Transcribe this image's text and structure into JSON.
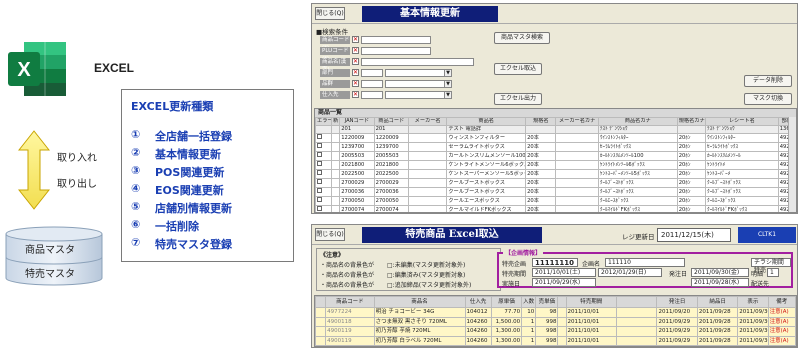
{
  "left": {
    "excel_label": "EXCEL",
    "arrow_in": "取り入れ",
    "arrow_out": "取り出し",
    "db_labels": [
      "商品マスタ",
      "特売マスタ"
    ],
    "types_title": "EXCEL更新種類",
    "types": [
      {
        "num": "①",
        "label": "全店舗一括登録"
      },
      {
        "num": "②",
        "label": "基本情報更新"
      },
      {
        "num": "③",
        "label": "POS関連更新"
      },
      {
        "num": "④",
        "label": "EOS関連更新"
      },
      {
        "num": "⑤",
        "label": "店舗別情報更新"
      },
      {
        "num": "⑥",
        "label": "一括削除"
      },
      {
        "num": "⑦",
        "label": "特売マスタ登録"
      }
    ]
  },
  "win1": {
    "close": "閉じる(Q)",
    "title": "基本情報更新",
    "search_label": "■検索条件",
    "fields": [
      "商品コード(*)",
      "PLUコード(*)",
      "商品名(漢字)",
      "部門",
      "品群",
      "仕入先"
    ],
    "field_checks": [
      "✕",
      "✕",
      "✕",
      "✕",
      "✕",
      "✕"
    ],
    "buttons": {
      "master_search": "商品マスタ検索",
      "excel_in": "エクセル取込",
      "excel_out": "エクセル出力",
      "data_delete": "データ削除",
      "mask_switch": "マスク切換"
    },
    "grid_title": "商品一覧",
    "headers": [
      "エラー",
      "新",
      "JANコード",
      "商品コード",
      "メーカー名",
      "商品名",
      "規格名",
      "メーカー名カナ",
      "商品名カナ",
      "規格名カナ",
      "レシート名",
      "部門"
    ],
    "filter_row": [
      "",
      "",
      "201",
      "201",
      "",
      "テスト 電話詳",
      "",
      "",
      "ﾃｽﾄ ﾃﾞﾝﾜｼｮｳ",
      "",
      "ﾃｽﾄ ﾃﾞﾝﾜｼｮｳ",
      "136"
    ],
    "rows": [
      [
        "1220009",
        "1220009",
        "",
        "ウィンストンフィルター",
        "20本",
        "",
        "ｳｲﾝｽﾄﾝﾌｨﾙﾀｰ",
        "20ﾎﾝ",
        "ｳｲﾝｽﾄﾝﾌｨﾙﾀｰ",
        "492"
      ],
      [
        "1239700",
        "1239700",
        "",
        "セーラムライトボックス",
        "20本",
        "",
        "ｾｰﾗﾑﾗｲﾄﾎﾞｯｸｽ",
        "20ﾎﾝ",
        "ｾｰﾗﾑﾗｲﾄﾎﾞｯｸｽ",
        "492"
      ],
      [
        "2005503",
        "2005503",
        "",
        "カールトンスリムメンソール100",
        "20本",
        "",
        "ｶｰﾙﾄﾝｽﾘﾑﾒﾝｿｰﾙ100",
        "20ﾎﾝ",
        "ｶｰﾙﾄﾝｽﾘﾑﾒﾝｿｰﾙ",
        "492"
      ],
      [
        "2021800",
        "2021800",
        "",
        "ケントライトメンソール6ボックス",
        "20本",
        "",
        "ｹﾝﾄﾗｲﾄﾒﾝｿｰﾙ6ﾎﾞｯｸｽ",
        "20ﾎﾝ",
        "ｹﾝﾄﾗｲﾄﾒ",
        "492"
      ],
      [
        "2022500",
        "2022500",
        "",
        "ケントスーパーメンソール5ボックス",
        "20本",
        "",
        "ｹﾝﾄｽｰﾊﾟｰﾒﾝｿｰﾙ5ﾎﾞｯｸｽ",
        "20ﾎﾝ",
        "ｹﾝﾄｽｰﾊﾟｰﾒ",
        "492"
      ],
      [
        "2700029",
        "2700029",
        "",
        "クールブーストボックス",
        "20本",
        "",
        "ｸｰﾙﾌﾞｰｽﾄﾎﾞｯｸｽ",
        "20ﾎﾝ",
        "ｸｰﾙﾌﾞｰｽﾄﾎﾞｯｸｽ",
        "492"
      ],
      [
        "2700036",
        "2700036",
        "",
        "クールブーストボックス",
        "20本",
        "",
        "ｸｰﾙﾌﾞｰｽﾄﾎﾞｯｸｽ",
        "20ﾎﾝ",
        "ｸｰﾙﾌﾞｰｽﾄﾎﾞｯｸｽ",
        "492"
      ],
      [
        "2700050",
        "2700050",
        "",
        "クールエースボックス",
        "20本",
        "",
        "ｸｰﾙｴｰｽﾎﾞｯｸｽ",
        "20ﾎﾝ",
        "ｸｰﾙｴｰｽﾎﾞｯｸｽ",
        "492"
      ],
      [
        "2700074",
        "2700074",
        "",
        "クールマイルドFKボックス",
        "20本",
        "",
        "ｸｰﾙﾏｲﾙﾄﾞFKﾎﾞｯｸｽ",
        "20ﾎﾝ",
        "ｸｰﾙﾏｲﾙﾄﾞFKﾎﾞｯｸｽ",
        "492"
      ]
    ]
  },
  "win2": {
    "close": "閉じる(Q)",
    "title": "特売商品 Excel取込",
    "reg_label": "レジ更新日",
    "reg_date": "2011/12/15(木)",
    "cltk": "CLTK1",
    "notice_title": "《注意》",
    "notices": [
      "・商品名の背景色が",
      "・商品名の背景色が",
      "・商品名の背景色が"
    ],
    "notice_vals": [
      "□:未編集(マスタ更新対象外)",
      "□:編集済み(マスタ更新対象)",
      "□:追加締品(マスタ更新対象外)"
    ],
    "info_title": "【企画情報】",
    "kikaku_label": "特売企画",
    "kikaku_code": "11111110",
    "kikaku_name_label": "企画名",
    "kikaku_name": "111110",
    "kikan_label": "特売期間",
    "kikan_from": "2011/10/01(土)",
    "kikan_to": "2012/01/29(日)",
    "jisshi_label": "実施日",
    "jisshi_date": "2011/09/29(水)",
    "hacchu_label": "発注日",
    "hacchu_from": "2011/09/30(金)",
    "hacchu_to": "2011/09/28(水)",
    "chirashi_label": "チラシ期間特売",
    "meisai_label": "明細",
    "meisai_val": "1",
    "haiso_label": "配送先",
    "grid2_headers": [
      "",
      "商品コード",
      "商品名",
      "仕入先",
      "原単価",
      "入数",
      "売単価",
      "",
      "特売期間",
      "",
      "発注日",
      "納品日",
      "表示",
      "備考"
    ],
    "grid2_rows": [
      [
        "4977224",
        "明治 チョコービー 34G",
        "104012",
        "77.70",
        "10",
        "98",
        "2011/10/01",
        "2011/09/20",
        "2011/09/28",
        "2011/09/30",
        "注意(A)"
      ],
      [
        "4900118",
        "さつま無双 黒さそり 720ML",
        "104260",
        "1,500.00",
        "1",
        "998",
        "2011/10/01",
        "2011/09/29",
        "2011/09/28",
        "2011/09/30",
        "注意(A)"
      ],
      [
        "4900119",
        "初乃芳醇 芋焼 720ML",
        "104260",
        "1,300.00",
        "1",
        "998",
        "2011/10/01",
        "2011/09/29",
        "2011/09/28",
        "2011/09/30",
        "注意(A)"
      ],
      [
        "4900119",
        "初乃芳醇 白ラベル 720ML",
        "104260",
        "1,300.00",
        "1",
        "998",
        "2011/10/01",
        "2011/09/29",
        "2011/09/28",
        "2011/09/30",
        "注意(A)"
      ],
      [
        "4900119",
        "初乃芳醇 芋焼1升 1800ML",
        "104260",
        "1,300.00",
        "1",
        "998",
        "2011/10/01",
        "2011/09/29",
        "2011/09/28",
        "2011/09/30",
        "注意(A)"
      ]
    ]
  }
}
